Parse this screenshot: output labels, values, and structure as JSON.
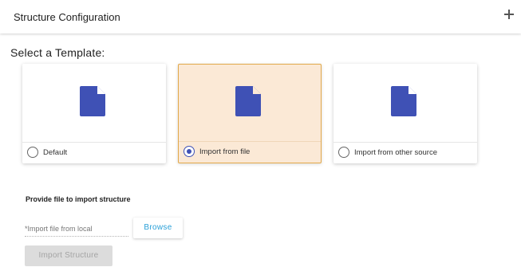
{
  "header": {
    "title": "Structure Configuration",
    "expand_icon": "plus-icon"
  },
  "template_section": {
    "label": "Select a Template:",
    "options": [
      {
        "label": "Default",
        "icon": "document-icon",
        "selected": false
      },
      {
        "label": "Import from file",
        "icon": "document-icon",
        "selected": true
      },
      {
        "label": "Import from other source",
        "icon": "document-icon",
        "selected": false
      }
    ]
  },
  "import_section": {
    "title": "Provide file to import structure",
    "field_label": "*Import file from local",
    "browse_label": "Browse",
    "import_button_label": "Import Structure"
  },
  "colors": {
    "accent": "#3f51b5",
    "selected_card_bg": "#fbe9d6",
    "selected_card_border": "#e2a94b",
    "link_blue": "#2aa0d8",
    "disabled_bg": "#dcdcdc"
  }
}
